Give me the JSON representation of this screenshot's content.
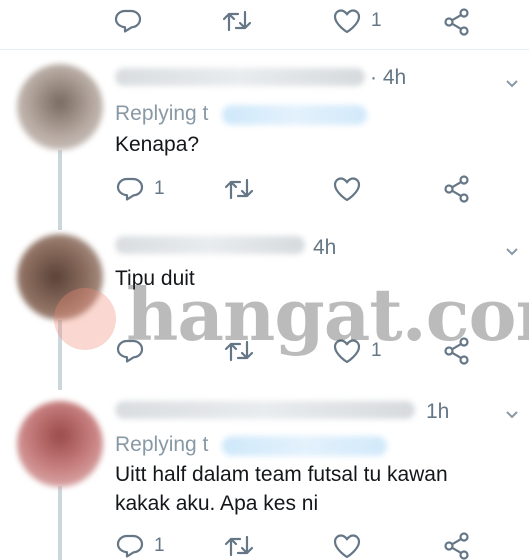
{
  "top_actions": {
    "reply_count": "",
    "retweet_count": "",
    "like_count": "1"
  },
  "tweets": [
    {
      "timestamp": "4h",
      "replying": "Replying t",
      "text": [
        "Kenapa?"
      ],
      "reply_count": "1",
      "retweet_count": "",
      "like_count": ""
    },
    {
      "timestamp": "4h",
      "replying": "",
      "text": [
        "Tipu duit"
      ],
      "reply_count": "",
      "retweet_count": "",
      "like_count": "1"
    },
    {
      "timestamp": "1h",
      "replying": "Replying t",
      "text": [
        "Uitt half dalam team futsal tu kawan",
        "kakak aku. Apa kes ni"
      ],
      "reply_count": "1",
      "retweet_count": "",
      "like_count": ""
    }
  ],
  "watermark": {
    "text": "hangat.com"
  },
  "colors": {
    "icon": "#657786",
    "divider": "#e6ecf0",
    "thread_line": "#ccd6dd",
    "link": "#1da1f2"
  },
  "icons": [
    "reply-icon",
    "retweet-icon",
    "like-icon",
    "share-icon",
    "chevron-down-icon"
  ]
}
